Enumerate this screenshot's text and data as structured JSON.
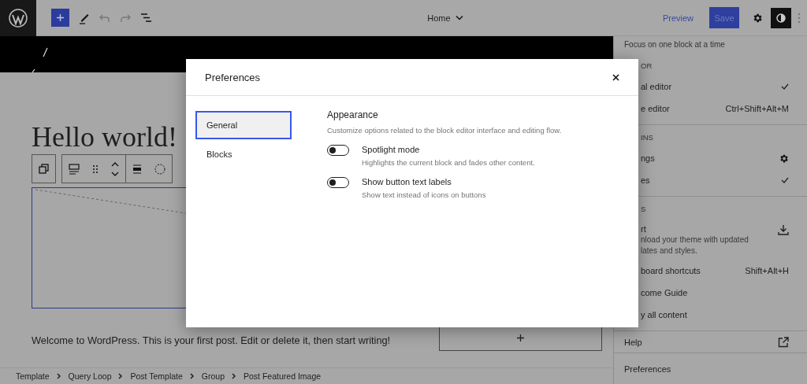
{
  "header": {
    "title": "Home",
    "preview": "Preview",
    "save": "Save"
  },
  "canvas": {
    "heading": "Hello world!",
    "paragraph": "Welcome to WordPress. This is your first post. Edit or delete it, then start writing!"
  },
  "breadcrumb": [
    "Template",
    "Query Loop",
    "Post Template",
    "Group",
    "Post Featured Image"
  ],
  "menu": {
    "note": "Focus on one block at a time",
    "groups": [
      {
        "label": "OR",
        "items": [
          {
            "kind": "check",
            "label": "al editor",
            "checked": true
          },
          {
            "kind": "shortcut",
            "label": "e editor",
            "shortcut": "Ctrl+Shift+Alt+M"
          }
        ]
      },
      {
        "label": "INS",
        "items": [
          {
            "kind": "gear",
            "label": "ngs"
          },
          {
            "kind": "check",
            "label": "es",
            "checked": true
          }
        ]
      },
      {
        "label": "S",
        "items": [
          {
            "kind": "download",
            "label": "rt",
            "description": [
              "nload your theme with updated",
              "lates and styles."
            ]
          },
          {
            "kind": "shortcut",
            "label": "board shortcuts",
            "shortcut": "Shift+Alt+H"
          },
          {
            "kind": "plain",
            "label": "come Guide"
          },
          {
            "kind": "plain",
            "label": "y all content"
          }
        ]
      }
    ],
    "help": {
      "kind": "external",
      "label": "Help"
    },
    "preferences": "Preferences"
  },
  "modal": {
    "title": "Preferences",
    "tabs": [
      {
        "label": "General",
        "selected": true
      },
      {
        "label": "Blocks",
        "selected": false
      }
    ],
    "section": {
      "title": "Appearance",
      "description": "Customize options related to the block editor interface and editing flow.",
      "options": [
        {
          "label": "Spotlight mode",
          "help": "Highlights the current block and fades other content.",
          "on": false
        },
        {
          "label": "Show button text labels",
          "help": "Show text instead of icons on buttons",
          "on": false
        }
      ]
    }
  }
}
